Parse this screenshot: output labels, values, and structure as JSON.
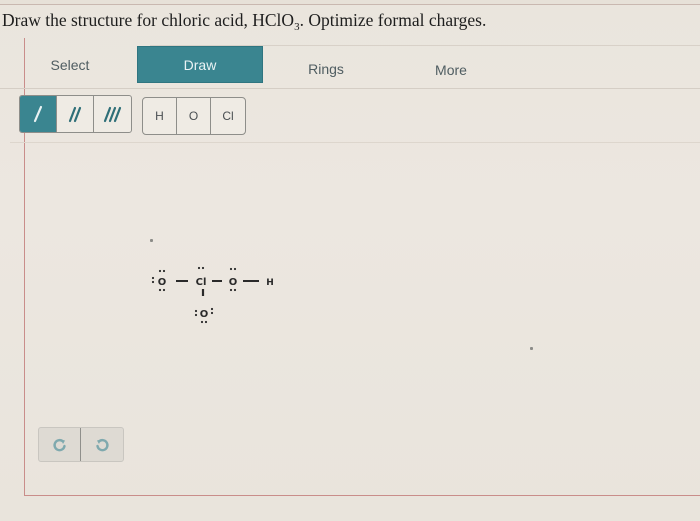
{
  "question": {
    "prefix": "Draw the structure for chloric acid, HClO",
    "subscript": "3",
    "suffix": ". Optimize formal charges."
  },
  "tabs": [
    {
      "label": "Select",
      "active": false
    },
    {
      "label": "Draw",
      "active": true
    },
    {
      "label": "Rings",
      "active": false
    },
    {
      "label": "More",
      "active": false
    }
  ],
  "bond_tools": [
    {
      "name": "single-bond",
      "icon": "single-bond-icon",
      "active": true
    },
    {
      "name": "double-bond",
      "icon": "double-bond-icon",
      "active": false
    },
    {
      "name": "triple-bond",
      "icon": "triple-bond-icon",
      "active": false
    }
  ],
  "atom_tools": [
    {
      "label": "H"
    },
    {
      "label": "O"
    },
    {
      "label": "Cl"
    }
  ],
  "molecule": {
    "atoms": [
      {
        "id": "O1",
        "symbol": "O",
        "lone_pairs": 3
      },
      {
        "id": "Cl",
        "symbol": "Cl",
        "lone_pairs": 1
      },
      {
        "id": "O2",
        "symbol": "O",
        "lone_pairs": 2
      },
      {
        "id": "H",
        "symbol": "H",
        "lone_pairs": 0
      },
      {
        "id": "O3",
        "symbol": "O",
        "lone_pairs": 3
      }
    ],
    "bonds": [
      {
        "from": "O1",
        "to": "Cl",
        "order": 1
      },
      {
        "from": "Cl",
        "to": "O2",
        "order": 1
      },
      {
        "from": "O2",
        "to": "H",
        "order": 1
      },
      {
        "from": "Cl",
        "to": "O3",
        "order": 1
      }
    ]
  },
  "history": {
    "undo_icon": "undo-icon",
    "redo_icon": "redo-icon"
  },
  "colors": {
    "accent": "#3a8590",
    "frame_border": "#c98d8a"
  }
}
